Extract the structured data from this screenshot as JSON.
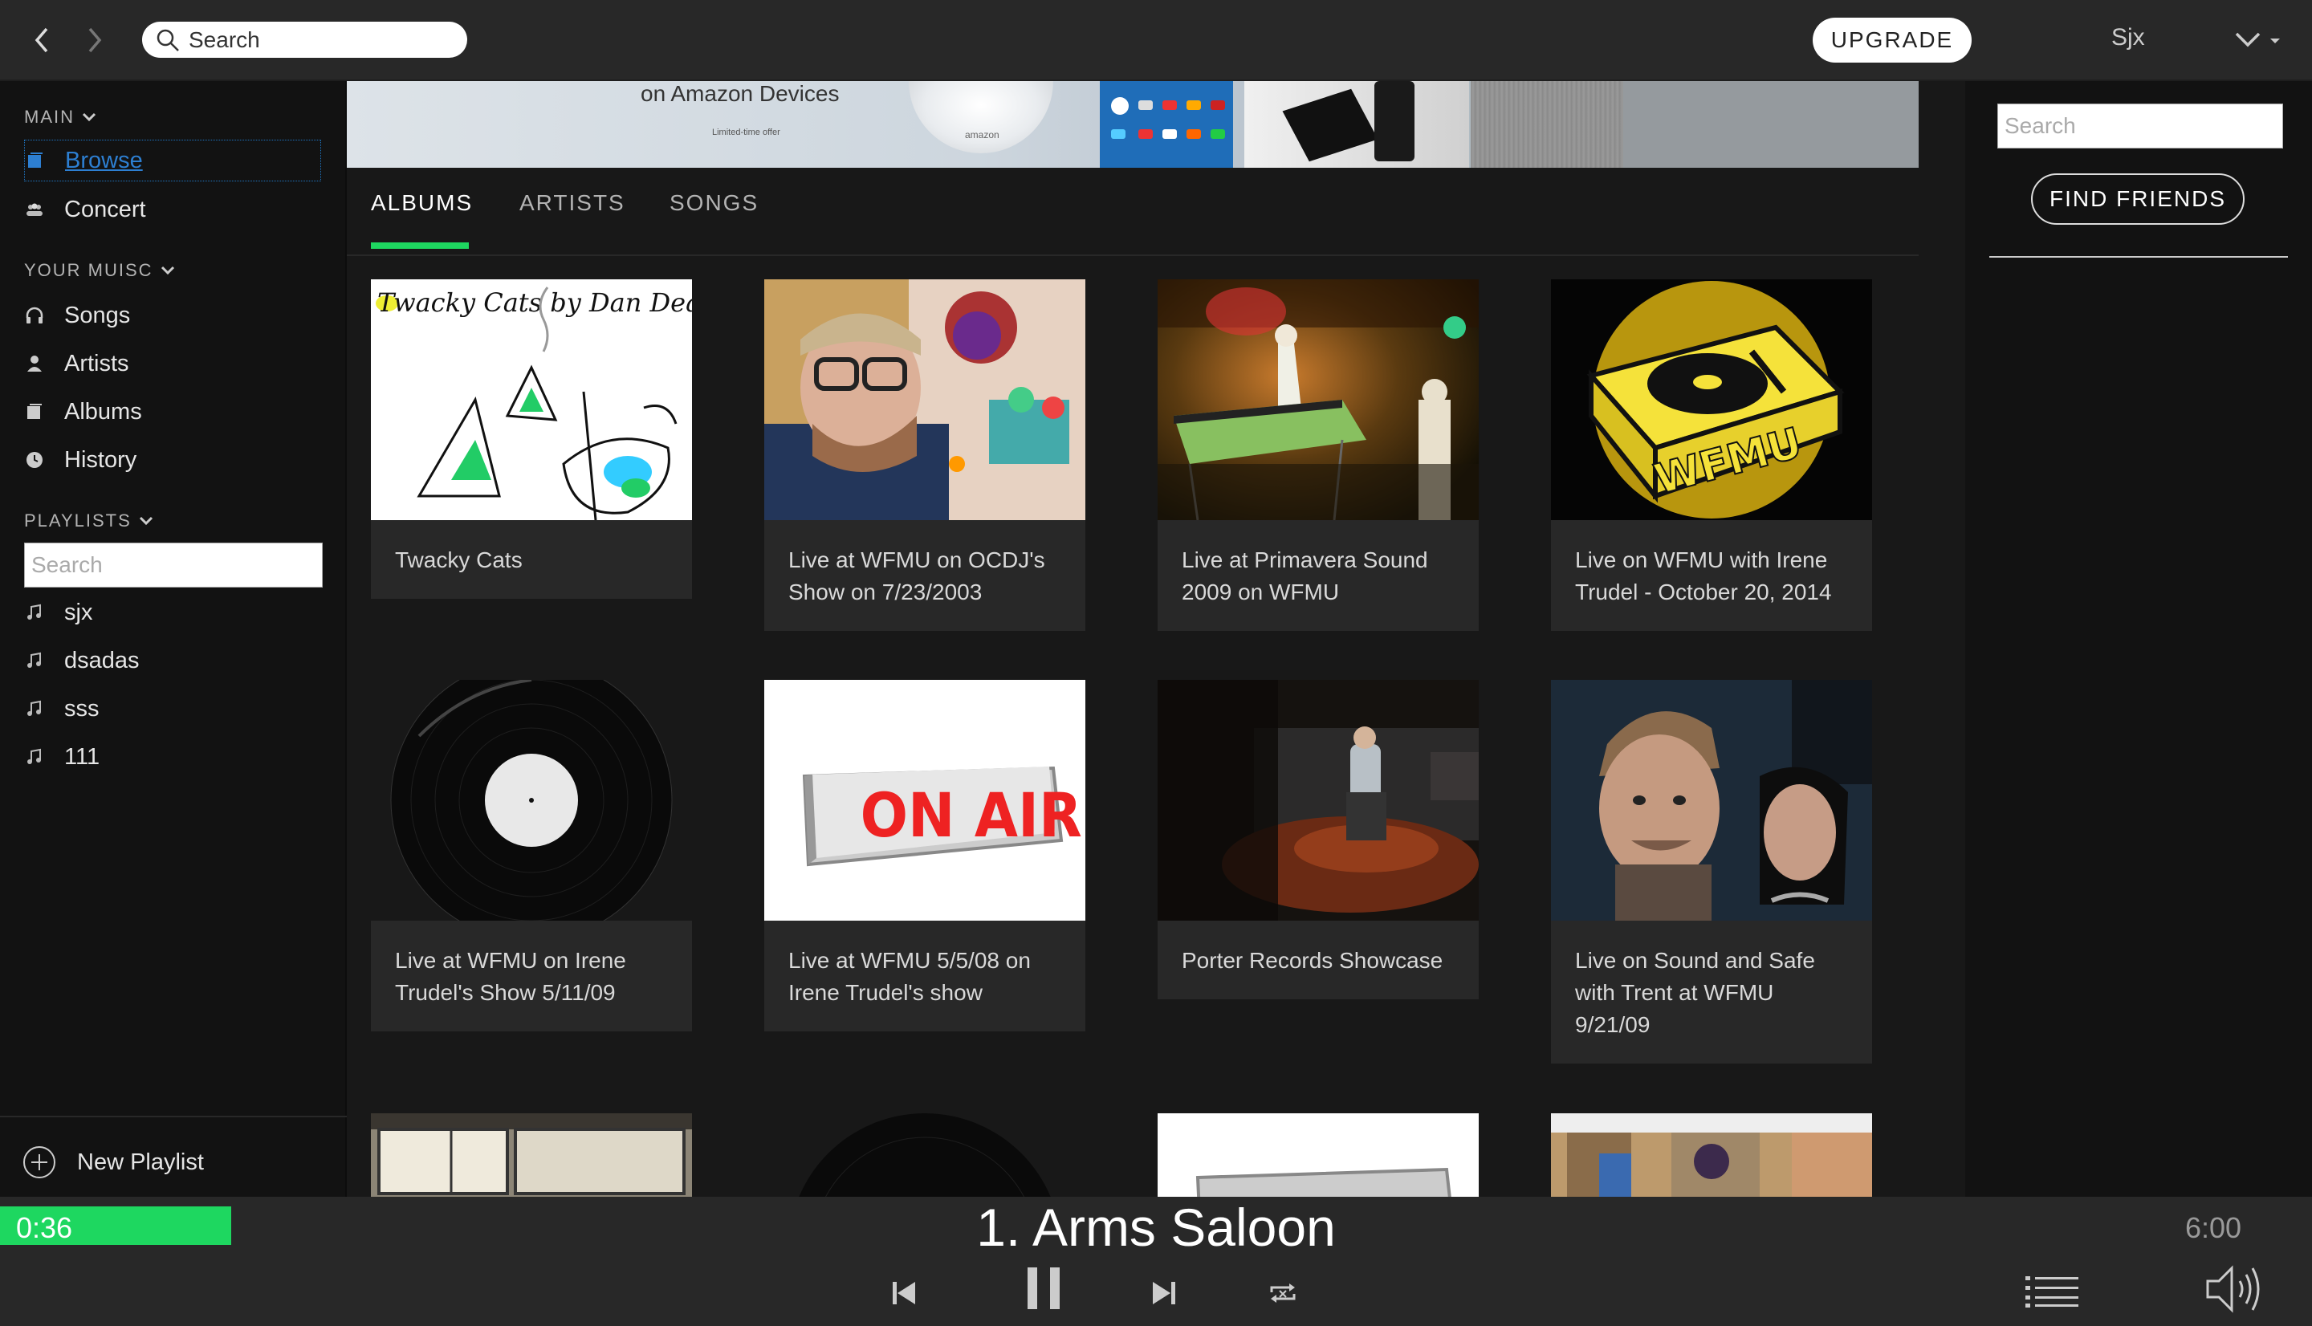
{
  "topbar": {
    "search_placeholder": "Search",
    "upgrade_label": "UPGRADE",
    "username": "Sjx"
  },
  "sidebar": {
    "main_title": "MAIN",
    "main_items": [
      {
        "label": "Browse",
        "icon": "browse-icon"
      },
      {
        "label": "Concert",
        "icon": "concert-icon"
      }
    ],
    "music_title": "YOUR MUISC",
    "music_items": [
      {
        "label": "Songs",
        "icon": "headphones-icon"
      },
      {
        "label": "Artists",
        "icon": "person-icon"
      },
      {
        "label": "Albums",
        "icon": "album-icon"
      },
      {
        "label": "History",
        "icon": "history-icon"
      }
    ],
    "playlists_title": "PLAYLISTS",
    "playlist_search_placeholder": "Search",
    "playlists": [
      {
        "label": "sjx",
        "icon": "music-note-icon"
      },
      {
        "label": "dsadas",
        "icon": "music-note-icon"
      },
      {
        "label": "sss",
        "icon": "music-note-icon"
      },
      {
        "label": "111",
        "icon": "music-note-icon"
      }
    ],
    "new_playlist_label": "New Playlist"
  },
  "banner": {
    "headline": "on Amazon Devices",
    "subline": "Limited-time offer",
    "device_label": "amazon"
  },
  "tabs": [
    {
      "label": "ALBUMS",
      "active": true
    },
    {
      "label": "ARTISTS",
      "active": false
    },
    {
      "label": "SONGS",
      "active": false
    }
  ],
  "albums": [
    {
      "title": "Twacky Cats",
      "art_text": "Twacky Cats by Dan Deacon"
    },
    {
      "title": "Live at WFMU on OCDJ's Show on 7/23/2003"
    },
    {
      "title": "Live at Primavera Sound 2009 on WFMU"
    },
    {
      "title": "Live on WFMU with Irene Trudel - October 20, 2014",
      "art_text": "WFMU"
    },
    {
      "title": "Live at WFMU on Irene Trudel's Show 5/11/09"
    },
    {
      "title": "Live at WFMU 5/5/08 on Irene Trudel's show",
      "art_text": "ON AIR"
    },
    {
      "title": "Porter Records Showcase"
    },
    {
      "title": "Live on Sound and Safe with Trent at WFMU 9/21/09"
    }
  ],
  "rpanel": {
    "search_placeholder": "Search",
    "find_friends_label": "FIND FRIENDS"
  },
  "player": {
    "current_time": "0:36",
    "total_time": "6:00",
    "track_title": "1. Arms Saloon",
    "progress": 0.1
  },
  "colors": {
    "accent": "#1ed760",
    "link": "#2d7fd2",
    "background": "#181818",
    "sidebar": "#121212",
    "bar": "#282828"
  }
}
